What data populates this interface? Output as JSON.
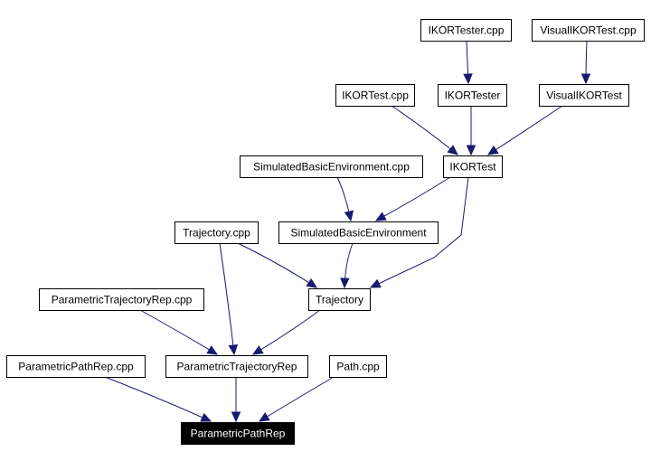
{
  "diagram": {
    "type": "include-dependency-graph",
    "colors": {
      "edge": "#191970",
      "node_border": "#000000",
      "node_fill": "#ffffff",
      "highlight_fill": "#000000",
      "highlight_text": "#ffffff"
    },
    "nodes": [
      {
        "id": "ikortester_cpp",
        "label": "IKORTester.cpp"
      },
      {
        "id": "visualikortest_cpp",
        "label": "VisualIKORTest.cpp"
      },
      {
        "id": "ikortest_cpp",
        "label": "IKORTest.cpp"
      },
      {
        "id": "ikortester",
        "label": "IKORTester"
      },
      {
        "id": "visualikortest",
        "label": "VisualIKORTest"
      },
      {
        "id": "simbasicenv_cpp",
        "label": "SimulatedBasicEnvironment.cpp"
      },
      {
        "id": "ikortest",
        "label": "IKORTest"
      },
      {
        "id": "trajectory_cpp",
        "label": "Trajectory.cpp"
      },
      {
        "id": "simbasicenv",
        "label": "SimulatedBasicEnvironment"
      },
      {
        "id": "paramtrajrep_cpp",
        "label": "ParametricTrajectoryRep.cpp"
      },
      {
        "id": "trajectory",
        "label": "Trajectory"
      },
      {
        "id": "parampathrep_cpp",
        "label": "ParametricPathRep.cpp"
      },
      {
        "id": "paramtrajrep",
        "label": "ParametricTrajectoryRep"
      },
      {
        "id": "path_cpp",
        "label": "Path.cpp"
      },
      {
        "id": "parampathrep",
        "label": "ParametricPathRep",
        "highlighted": true
      }
    ],
    "edges": [
      {
        "from": "ikortester_cpp",
        "to": "ikortester"
      },
      {
        "from": "visualikortest_cpp",
        "to": "visualikortest"
      },
      {
        "from": "ikortest_cpp",
        "to": "ikortest"
      },
      {
        "from": "ikortester",
        "to": "ikortest"
      },
      {
        "from": "visualikortest",
        "to": "ikortest"
      },
      {
        "from": "simbasicenv_cpp",
        "to": "simbasicenv"
      },
      {
        "from": "ikortest",
        "to": "simbasicenv"
      },
      {
        "from": "ikortest",
        "to": "trajectory"
      },
      {
        "from": "trajectory_cpp",
        "to": "trajectory"
      },
      {
        "from": "simbasicenv",
        "to": "trajectory"
      },
      {
        "from": "trajectory_cpp",
        "to": "paramtrajrep"
      },
      {
        "from": "paramtrajrep_cpp",
        "to": "paramtrajrep"
      },
      {
        "from": "trajectory",
        "to": "paramtrajrep"
      },
      {
        "from": "parampathrep_cpp",
        "to": "parampathrep"
      },
      {
        "from": "paramtrajrep",
        "to": "parampathrep"
      },
      {
        "from": "path_cpp",
        "to": "parampathrep"
      }
    ]
  }
}
